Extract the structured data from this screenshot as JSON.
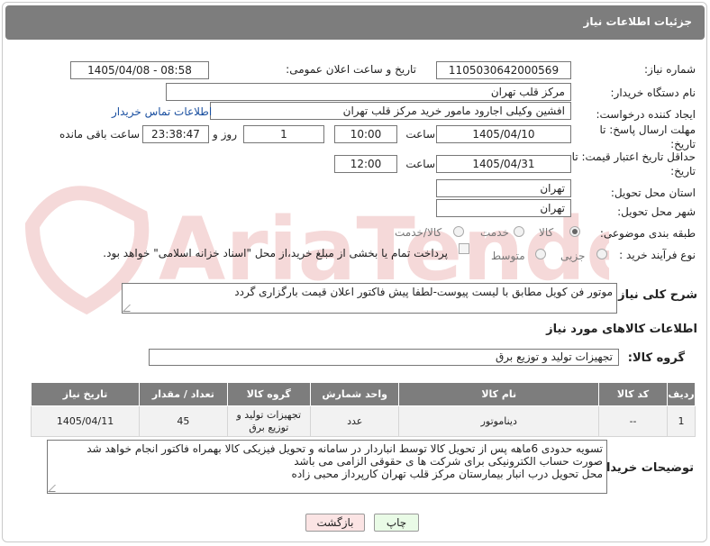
{
  "header": {
    "title": "جزئیات اطلاعات نیاز"
  },
  "form": {
    "need_number": {
      "label": "شماره نیاز:",
      "value": "1105030642000569"
    },
    "announce_datetime": {
      "label": "تاریخ و ساعت اعلان عمومی:",
      "value": "1405/04/08 - 08:58"
    },
    "buyer_org": {
      "label": "نام دستگاه خریدار:",
      "value": "مرکز قلب تهران"
    },
    "requester": {
      "label": "ایجاد کننده درخواست:",
      "value": "افشین وکیلی اجارود مامور خرید مرکز قلب تهران",
      "contact_link": "اطلاعات تماس خریدار"
    },
    "response_deadline": {
      "label": "مهلت ارسال پاسخ: تا تاریخ:",
      "date": "1405/04/10",
      "time_label": "ساعت",
      "time": "10:00",
      "days": "1",
      "days_label": "روز و",
      "remaining": "23:38:47",
      "remaining_label": "ساعت باقی مانده"
    },
    "price_validity": {
      "label": "حداقل تاریخ اعتبار قیمت: تا تاریخ:",
      "date": "1405/04/31",
      "time_label": "ساعت",
      "time": "12:00"
    },
    "delivery_province": {
      "label": "استان محل تحویل:",
      "value": "تهران"
    },
    "delivery_city": {
      "label": "شهر محل تحویل:",
      "value": "تهران"
    },
    "category": {
      "label": "طبقه بندی موضوعی:",
      "options": [
        "کالا",
        "خدمت",
        "کالا/خدمت"
      ],
      "selected": "کالا"
    },
    "purchase_process": {
      "label": "نوع فرآیند خرید :",
      "options": [
        "جزیی",
        "متوسط"
      ],
      "selected": "جزیی",
      "payment_note": "پرداخت تمام یا بخشی از مبلغ خرید،از محل \"اسناد خزانه اسلامی\" خواهد بود."
    }
  },
  "description": {
    "label": "شرح کلی نیاز:",
    "value": "موتور فن کویل مطابق با لیست پیوست-لطفا پیش فاکتور اعلان قیمت بارگزاری گردد"
  },
  "goods_section": {
    "title": "اطلاعات کالاهای مورد نیاز",
    "group_label": "گروه کالا:",
    "group_value": "تجهیزات تولید و توزیع برق"
  },
  "items_table": {
    "columns": [
      "ردیف",
      "کد کالا",
      "نام کالا",
      "واحد شمارش",
      "گروه کالا",
      "تعداد / مقدار",
      "تاریخ نیاز"
    ],
    "rows": [
      {
        "row": "1",
        "code": "--",
        "name": "دیناموتور",
        "unit": "عدد",
        "group": "تجهیزات تولید و توزیع برق",
        "qty": "45",
        "date": "1405/04/11"
      }
    ]
  },
  "buyer_notes": {
    "label": "توضیحات خریدار:",
    "lines": [
      "تسویه حدودی 6ماهه پس از تحویل کالا توسط انباردار در سامانه و تحویل فیزیکی کالا بهمراه فاکتور انجام خواهد شد",
      "صورت حساب الکترونیکی برای شرکت ها ی حقوقی الزامی می باشد",
      "محل تحویل درب انبار بیمارستان مرکز قلب تهران کارپرداز محبی زاده"
    ]
  },
  "buttons": {
    "print": "چاپ",
    "back": "بازگشت"
  },
  "watermark": {
    "text": "AriaTender.net"
  }
}
